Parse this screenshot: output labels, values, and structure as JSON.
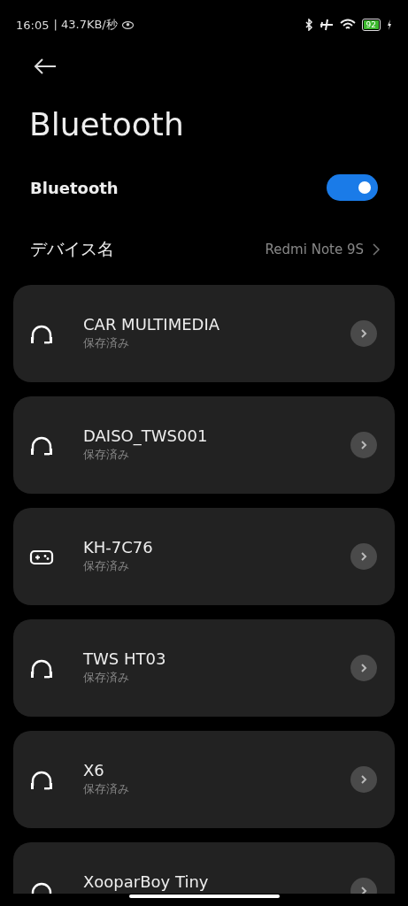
{
  "status_bar": {
    "time": "16:05",
    "speed": "| 43.7KB/秒",
    "battery": "92"
  },
  "title": "Bluetooth",
  "bluetooth_toggle": {
    "label": "Bluetooth",
    "on": true
  },
  "device_name": {
    "label": "デバイス名",
    "value": "Redmi Note 9S"
  },
  "devices": [
    {
      "name": "CAR MULTIMEDIA",
      "status": "保存済み",
      "kind": "headphones"
    },
    {
      "name": "DAISO_TWS001",
      "status": "保存済み",
      "kind": "headphones"
    },
    {
      "name": "KH-7C76",
      "status": "保存済み",
      "kind": "gamepad"
    },
    {
      "name": "TWS HT03",
      "status": "保存済み",
      "kind": "headphones"
    },
    {
      "name": "X6",
      "status": "保存済み",
      "kind": "headphones"
    },
    {
      "name": "XooparBoy Tiny",
      "kind": "headphones"
    }
  ]
}
